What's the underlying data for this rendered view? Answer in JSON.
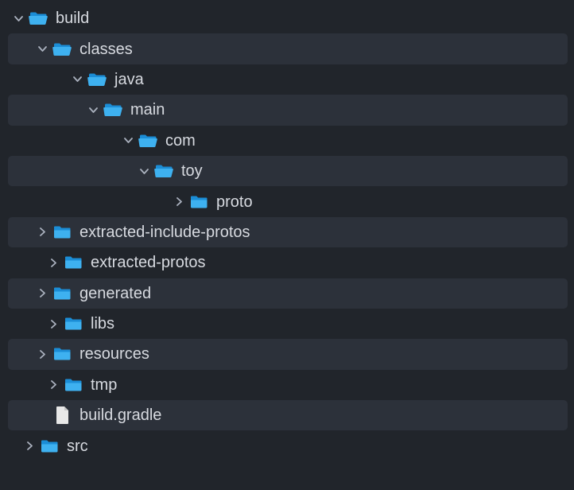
{
  "tree": {
    "build": "build",
    "classes": "classes",
    "java": "java",
    "main": "main",
    "com": "com",
    "toy": "toy",
    "proto": "proto",
    "extracted_include_protos": "extracted-include-protos",
    "extracted_protos": "extracted-protos",
    "generated": "generated",
    "libs": "libs",
    "resources": "resources",
    "tmp": "tmp",
    "build_gradle": "build.gradle",
    "src": "src"
  },
  "indent_base": 14,
  "indent_step": 30
}
